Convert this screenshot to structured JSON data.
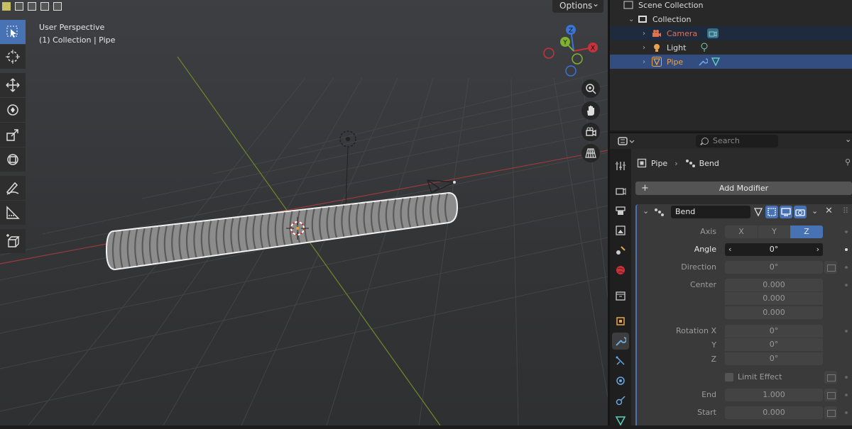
{
  "viewport": {
    "perspective_label": "User Perspective",
    "collection_label": "(1) Collection | Pipe",
    "options_label": "Options",
    "gizmo_axes": {
      "x": "X",
      "y": "Y",
      "z": "Z"
    }
  },
  "toolbar": {
    "tools": [
      "select-box",
      "cursor",
      "move",
      "rotate",
      "scale",
      "transform",
      "annotate",
      "measure",
      "add-cube"
    ],
    "active": "select-box"
  },
  "outliner": {
    "root": "Scene Collection",
    "collection": "Collection",
    "items": [
      {
        "label": "Camera",
        "color": "#e0734d"
      },
      {
        "label": "Light",
        "color": "#e0e0e0"
      },
      {
        "label": "Pipe",
        "color": "#e8a54d"
      }
    ]
  },
  "properties": {
    "search_placeholder": "Search",
    "breadcrumb": {
      "object": "Pipe",
      "modifier": "Bend"
    },
    "add_modifier": "Add Modifier",
    "modifier": {
      "name": "Bend",
      "axis_label": "Axis",
      "axes": [
        "X",
        "Y",
        "Z"
      ],
      "active_axis": "Z",
      "angle_label": "Angle",
      "angle_value": "0°",
      "direction_label": "Direction",
      "direction_value": "0°",
      "center_label": "Center",
      "center_values": [
        "0.000",
        "0.000",
        "0.000"
      ],
      "rotation_label": "Rotation X",
      "rotation_y_label": "Y",
      "rotation_z_label": "Z",
      "rotation_values": [
        "0°",
        "0°",
        "0°"
      ],
      "limit_effect_label": "Limit Effect",
      "end_label": "End",
      "end_value": "1.000",
      "start_label": "Start",
      "start_value": "0.000"
    }
  },
  "colors": {
    "accent": "#4772b3",
    "x_axis": "#c8323c",
    "y_axis": "#7fb22f",
    "z_axis": "#3b73d6"
  }
}
